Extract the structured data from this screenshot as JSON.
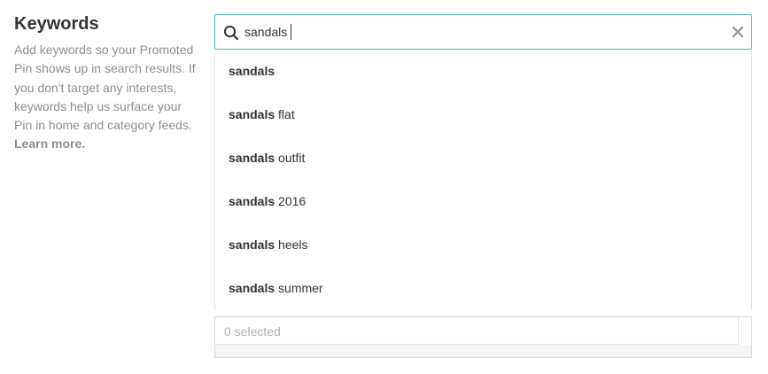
{
  "section": {
    "title": "Keywords",
    "description": "Add keywords so your Promoted Pin shows up in search results. If you don't target any interests, keywords help us surface your Pin in home and category feeds. ",
    "learn_more": "Learn more."
  },
  "search": {
    "value": "sandals",
    "icon": "search-icon",
    "clear_icon": "close-icon"
  },
  "suggestions": [
    {
      "term": "sandals",
      "rest": ""
    },
    {
      "term": "sandals",
      "rest": " flat"
    },
    {
      "term": "sandals",
      "rest": " outfit"
    },
    {
      "term": "sandals",
      "rest": " 2016"
    },
    {
      "term": "sandals",
      "rest": " heels"
    },
    {
      "term": "sandals",
      "rest": " summer"
    }
  ],
  "selected": {
    "label": "0 selected"
  },
  "colors": {
    "accent": "#4fb8c6",
    "text": "#333333",
    "muted": "#8e8e8e"
  }
}
